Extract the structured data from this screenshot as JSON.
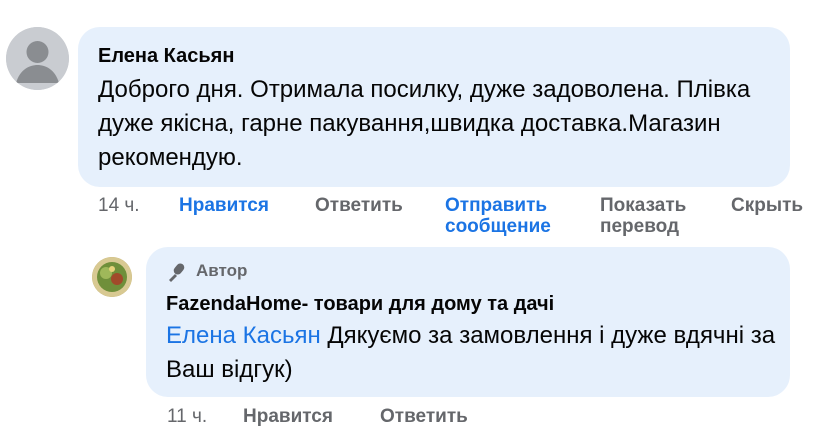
{
  "comment": {
    "author": "Елена Касьян",
    "text": "Доброго дня. Отримала посилку, дуже задоволена. Плівка дуже якісна, гарне пакування,швидка доставка.Магазин рекомендую.",
    "actions": {
      "time": "14 ч.",
      "like": "Нравится",
      "reply": "Ответить",
      "send_message_line1": "Отправить",
      "send_message_line2": "сообщение",
      "translate_line1": "Показать",
      "translate_line2": "перевод",
      "hide": "Скрыть"
    }
  },
  "reply": {
    "badge": "Автор",
    "author": "FazendaHome- товари для дому та дачі",
    "mention": "Елена Касьян",
    "text": " Дякуємо за замовлення і дуже вдячні за Ваш відгук)",
    "actions": {
      "time": "11 ч.",
      "like": "Нравится",
      "reply": "Ответить"
    }
  },
  "colors": {
    "bubble": "#e6f0fc",
    "link_blue": "#1b74e4",
    "muted": "#65676b"
  },
  "icons": {
    "badge_icon": "microphone-icon",
    "main_avatar": "default-avatar-icon"
  }
}
